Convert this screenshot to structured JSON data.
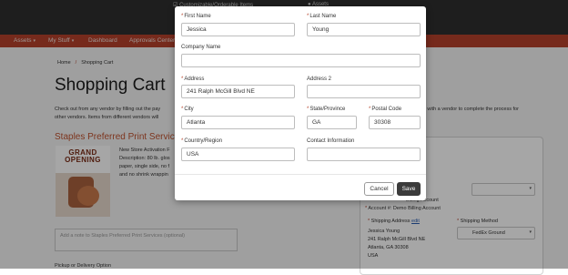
{
  "header": {
    "customizable_label": "Customizable/Orderable Items",
    "assets_label": "Assets"
  },
  "nav": {
    "items": [
      {
        "label": "Assets",
        "caret": "▾"
      },
      {
        "label": "My Stuff",
        "caret": "▾"
      },
      {
        "label": "Dashboard",
        "caret": ""
      },
      {
        "label": "Approvals Center",
        "caret": ""
      }
    ]
  },
  "breadcrumb": {
    "home": "Home",
    "separator": "/",
    "current": "Shopping Cart"
  },
  "page": {
    "title": "Shopping Cart",
    "intro_line1_left": "Check out from any vendor by filling out the pay",
    "intro_line1_right": "r with a vendor to complete the process for",
    "intro_line2": "other vendors. Items from different vendors will"
  },
  "vendor": {
    "title": "Staples Preferred Print Services",
    "promo_line1": "GRAND",
    "promo_line2": "OPENING",
    "desc_lines": [
      "New Store Activation F",
      "Description: 80 lb. glos",
      "paper, single side, no f",
      "and no shrink wrappin"
    ],
    "note_placeholder": "Add a note to Staples Preferred Print Services (optional)",
    "pickup_label": "Pickup or Delivery Option"
  },
  "summary": {
    "billing_account": "Billing Account",
    "account_line": "Account #: Demo Billing Account",
    "shipping_address_label": "Shipping Address",
    "edit_link": "edit",
    "address_lines": [
      "Jessica Young",
      "241 Ralph McGill Blvd NE",
      "Atlanta, GA 30308",
      "USA"
    ],
    "shipping_method_label": "Shipping Method",
    "shipping_method_value": "FedEx Ground"
  },
  "modal": {
    "first_name_label": "First Name",
    "first_name": "Jessica",
    "last_name_label": "Last Name",
    "last_name": "Young",
    "company_label": "Company Name",
    "company": "",
    "address_label": "Address",
    "address": "241 Ralph McGill Blvd NE",
    "address2_label": "Address 2",
    "address2": "",
    "city_label": "City",
    "city": "Atlanta",
    "state_label": "State/Province",
    "state": "GA",
    "postal_label": "Postal Code",
    "postal": "30308",
    "country_label": "Country/Region",
    "country": "USA",
    "contact_label": "Contact Information",
    "contact": "",
    "required_mark": "*",
    "cancel_label": "Cancel",
    "save_label": "Save"
  },
  "colors": {
    "brand": "#b5412b",
    "nav_bg": "#b5412b",
    "topbar": "#2f2f2f",
    "save_button": "#3b3b3b"
  }
}
